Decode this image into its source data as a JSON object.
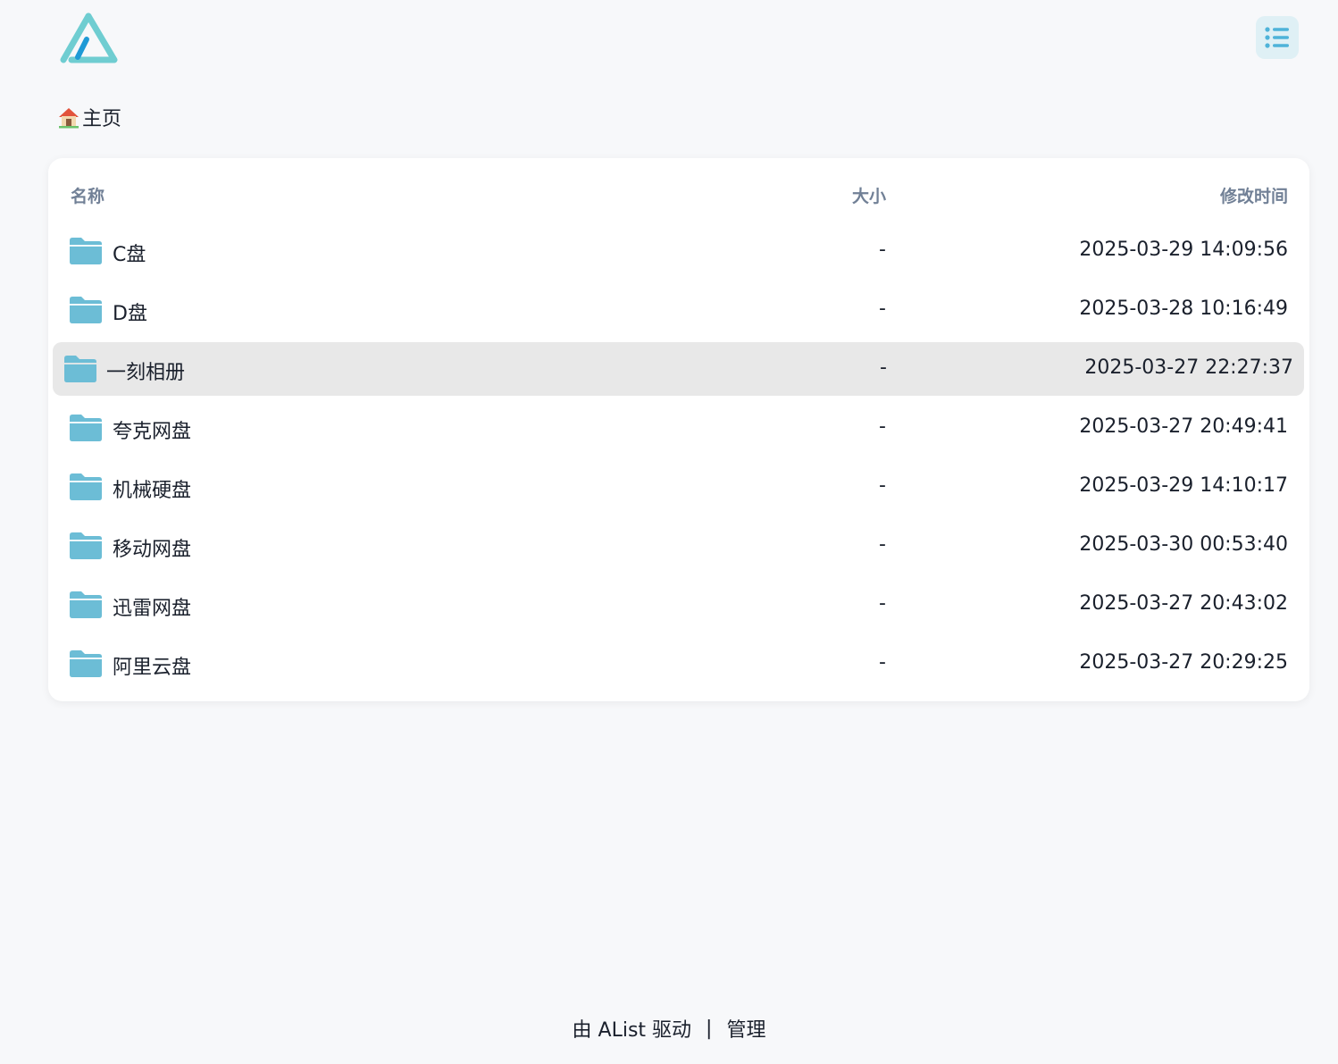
{
  "header": {
    "logo_icon": "alist-logo-icon",
    "menu_icon": "list-icon",
    "accent_color": "#4fc3d8"
  },
  "breadcrumb": {
    "icon": "house-icon",
    "label": "主页"
  },
  "table": {
    "columns": {
      "name": "名称",
      "size": "大小",
      "modified": "修改时间"
    },
    "rows": [
      {
        "name": "C盘",
        "size": "-",
        "modified": "2025-03-29 14:09:56",
        "icon": "folder-icon"
      },
      {
        "name": "D盘",
        "size": "-",
        "modified": "2025-03-28 10:16:49",
        "icon": "folder-icon"
      },
      {
        "name": "一刻相册",
        "size": "-",
        "modified": "2025-03-27 22:27:37",
        "icon": "folder-icon",
        "hovered": true
      },
      {
        "name": "夸克网盘",
        "size": "-",
        "modified": "2025-03-27 20:49:41",
        "icon": "folder-icon"
      },
      {
        "name": "机械硬盘",
        "size": "-",
        "modified": "2025-03-29 14:10:17",
        "icon": "folder-icon"
      },
      {
        "name": "移动网盘",
        "size": "-",
        "modified": "2025-03-30 00:53:40",
        "icon": "folder-icon"
      },
      {
        "name": "迅雷网盘",
        "size": "-",
        "modified": "2025-03-27 20:43:02",
        "icon": "folder-icon"
      },
      {
        "name": "阿里云盘",
        "size": "-",
        "modified": "2025-03-27 20:29:25",
        "icon": "folder-icon"
      }
    ]
  },
  "footer": {
    "powered_by": "由 AList 驱动",
    "separator": "|",
    "admin_link": "管理"
  }
}
